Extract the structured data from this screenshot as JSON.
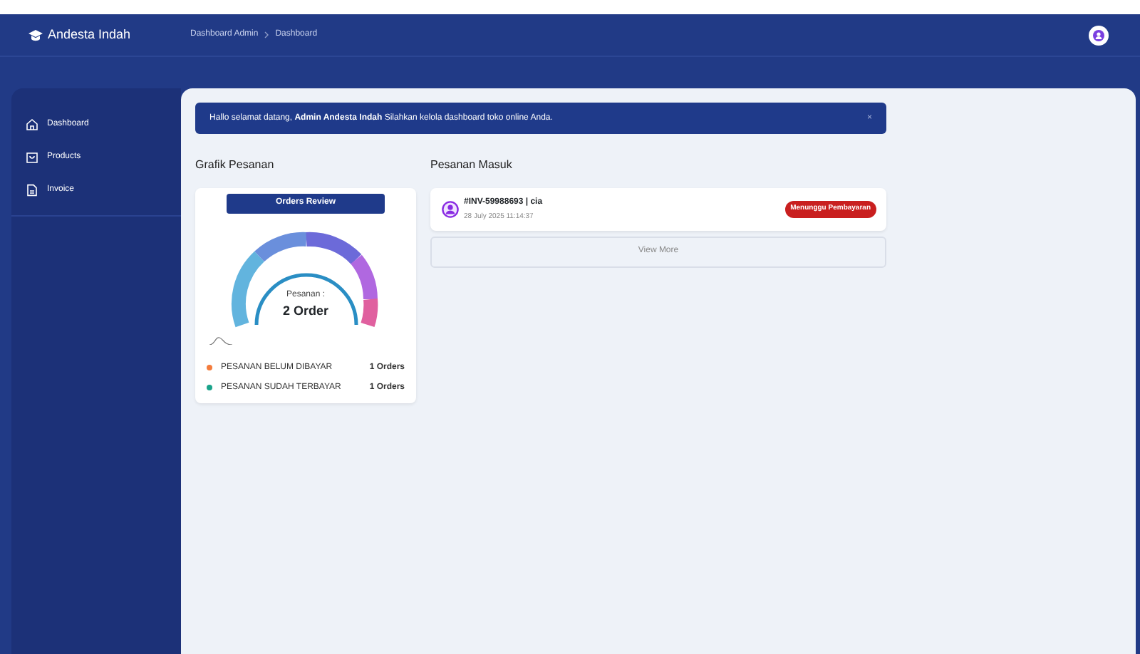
{
  "brand": "Andesta Indah",
  "breadcrumb": [
    "Dashboard Admin",
    "Dashboard"
  ],
  "sidebar": {
    "items": [
      {
        "label": "Dashboard"
      },
      {
        "label": "Products"
      },
      {
        "label": "Invoice"
      }
    ]
  },
  "alert": {
    "text": "Hallo selamat datang, **Admin Andesta Indah** Silahkan kelola dashboard toko online Anda.",
    "close": "×"
  },
  "chart_panel": {
    "title": "Grafik Pesanan",
    "button": "Orders Review",
    "gauge_label": "Pesanan :",
    "gauge_value": "2 Order",
    "legend": [
      {
        "label": "PESANAN BELUM DIBAYAR",
        "count": "1 Orders",
        "color": "#f47c3c"
      },
      {
        "label": "PESANAN SUDAH TERBAYAR",
        "count": "1 Orders",
        "color": "#1aa38a"
      }
    ]
  },
  "orders_panel": {
    "title": "Pesanan Masuk",
    "orders": [
      {
        "id": "#INV-59988693 | cia",
        "date": "28 July 2025 11:14:37",
        "status": "Menunggu Pembayaran"
      }
    ],
    "view_more": "View More"
  }
}
